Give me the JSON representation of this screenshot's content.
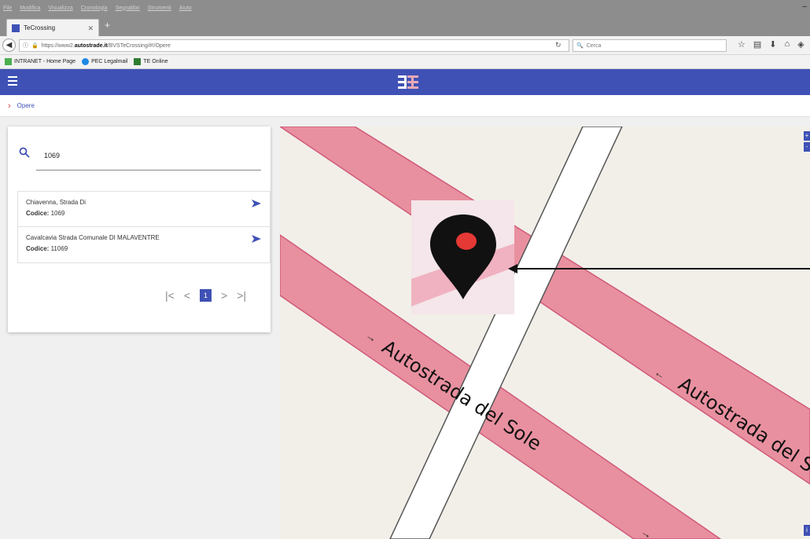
{
  "browser": {
    "menu": [
      "File",
      "Modifica",
      "Visualizza",
      "Cronologia",
      "Segnalibri",
      "Strumenti",
      "Aiuto"
    ],
    "tab_title": "TeCrossing",
    "url_prefix": "https://www2.",
    "url_domain": "autostrade.it",
    "url_path": "/BVSTeCrossing/#!/Opere",
    "search_placeholder": "Cerca",
    "bookmarks": [
      "INTRANET - Home Page",
      "PEC Legalmail",
      "TE Online"
    ]
  },
  "app": {
    "breadcrumb": "Opere",
    "search_value": "1069",
    "code_label": "Codice:",
    "results": [
      {
        "name": "Chiavenna, Strada Di",
        "code": "1069"
      },
      {
        "name": "Cavalcavia Strada Comunale DI MALAVENTRE",
        "code": "11069"
      }
    ],
    "pager": {
      "first": "|<",
      "prev": "<",
      "current": "1",
      "next": ">",
      "last": ">|"
    }
  },
  "map": {
    "road_label_1": "Autostrada del Sole",
    "road_label_2": "Autostrada del S",
    "zoom_in": "+",
    "zoom_out": "-",
    "info": "i",
    "colors": {
      "road": "#e8909f",
      "road_edge": "#d05a7a",
      "land": "#f2efe9",
      "marker": "#111111",
      "marker_dot": "#e53935"
    }
  }
}
